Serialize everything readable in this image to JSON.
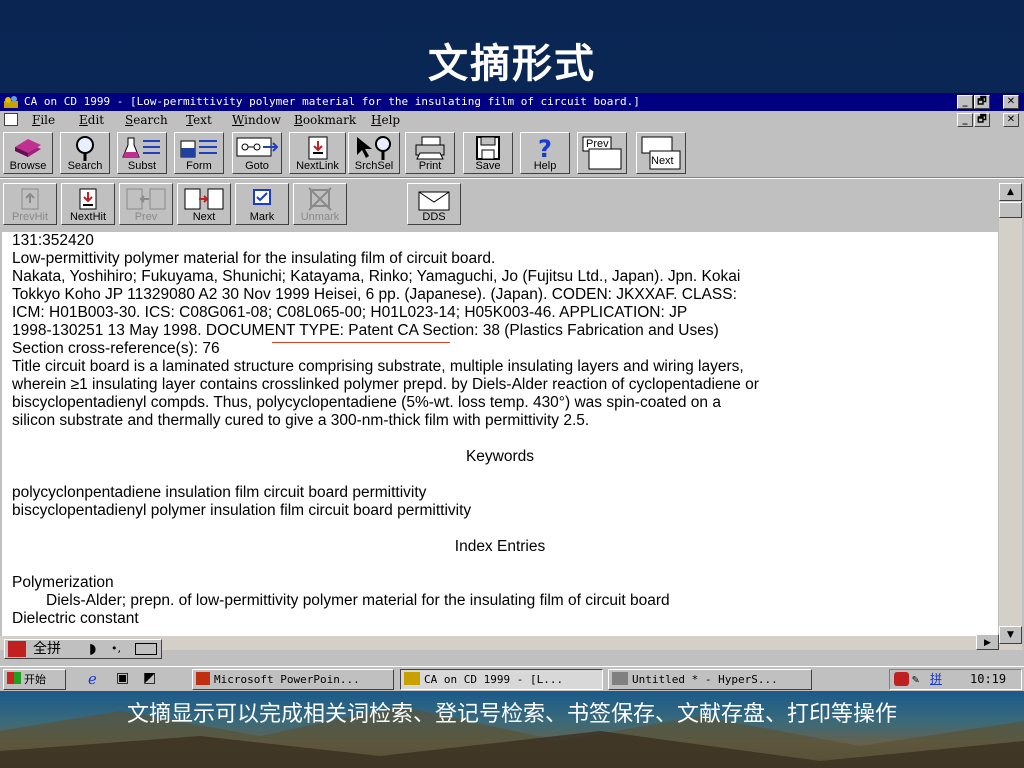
{
  "slide": {
    "title": "文摘形式",
    "caption": "文摘显示可以完成相关词检索、登记号检索、书签保存、文献存盘、打印等操作"
  },
  "window": {
    "title": "CA on CD 1999  - [Low-permittivity polymer material for the insulating film of circuit board.]",
    "controls": [
      "_",
      "🗗",
      "✕"
    ]
  },
  "menu": [
    "File",
    "Edit",
    "Search",
    "Text",
    "Window",
    "Bookmark",
    "Help"
  ],
  "toolbar1": [
    {
      "label": "Browse",
      "icon": "books-icon"
    },
    {
      "label": "Search",
      "icon": "magnifier-icon"
    },
    {
      "label": "Subst",
      "icon": "flask-icon"
    },
    {
      "label": "Form",
      "icon": "formula-icon"
    },
    {
      "label": "Goto",
      "icon": "goto-icon"
    },
    {
      "label": "NextLink",
      "icon": "nextlink-icon"
    },
    {
      "label": "SrchSel",
      "icon": "search-select-icon"
    },
    {
      "label": "Print",
      "icon": "printer-icon"
    },
    {
      "label": "Save",
      "icon": "floppy-icon"
    },
    {
      "label": "Help",
      "icon": "help-icon"
    },
    {
      "label": "Prev",
      "icon": "prev-doc-icon"
    },
    {
      "label": "Next",
      "icon": "next-doc-icon"
    }
  ],
  "toolbar2": [
    {
      "label": "PrevHit",
      "icon": "prevhit-icon",
      "enabled": false
    },
    {
      "label": "NextHit",
      "icon": "nexthit-icon",
      "enabled": true
    },
    {
      "label": "Prev",
      "icon": "prev-page-icon",
      "enabled": false
    },
    {
      "label": "Next",
      "icon": "next-page-icon",
      "enabled": true
    },
    {
      "label": "Mark",
      "icon": "checkbox-icon",
      "enabled": true
    },
    {
      "label": "Unmark",
      "icon": "unmark-icon",
      "enabled": false
    },
    {
      "label": "DDS",
      "icon": "envelope-icon",
      "enabled": true
    }
  ],
  "record": {
    "id": "131:352420",
    "title": "Low-permittivity polymer material for the insulating film of circuit board.",
    "lines": [
      "Nakata, Yoshihiro; Fukuyama, Shunichi; Katayama, Rinko; Yamaguchi, Jo (Fujitsu Ltd., Japan).  Jpn. Kokai",
      "Tokkyo Koho JP 11329080 A2 30 Nov 1999 Heisei, 6 pp.  (Japanese). (Japan).  CODEN: JKXXAF.  CLASS:",
      "ICM: H01B003-30.  ICS: C08G061-08; C08L065-00; H01L023-14; H05K003-46.  APPLICATION: JP",
      "1998-130251 13 May 1998.  DOCUMENT TYPE: Patent CA Section: 38 (Plastics Fabrication and Uses)",
      "Section cross-reference(s): 76",
      "Title circuit board is a laminated structure comprising substrate, multiple insulating layers and wiring layers,",
      "wherein ≥1 insulating layer contains crosslinked polymer prepd. by Diels-Alder reaction of cyclopentadiene or",
      "biscyclopentadienyl compds.  Thus, polycyclopentadiene (5%-wt. loss temp. 430°) was spin-coated on a",
      "silicon substrate and thermally cured to give a 300-nm-thick film with permittivity 2.5."
    ],
    "keywords_heading": "Keywords",
    "keywords": [
      "polycyclonpentadiene insulation film circuit board permittivity",
      "biscyclopentadienyl polymer insulation film circuit board permittivity"
    ],
    "index_heading": "Index Entries",
    "index_entries": [
      "Polymerization",
      "Diels-Alder; prepn. of low-permittivity polymer material for the insulating film of circuit board",
      "Dielectric constant"
    ]
  },
  "ime": {
    "mode": "全拼"
  },
  "taskbar": {
    "start": "开始",
    "tasks": [
      "Microsoft PowerPoin...",
      "CA on CD 1999  - [L...",
      "Untitled * - HyperS..."
    ],
    "clock": "10:19",
    "tray_label": "拼"
  },
  "colors": {
    "title_bar": "#000080",
    "face": "#c0c0c0",
    "slide_bg": "#0b2a5a"
  }
}
